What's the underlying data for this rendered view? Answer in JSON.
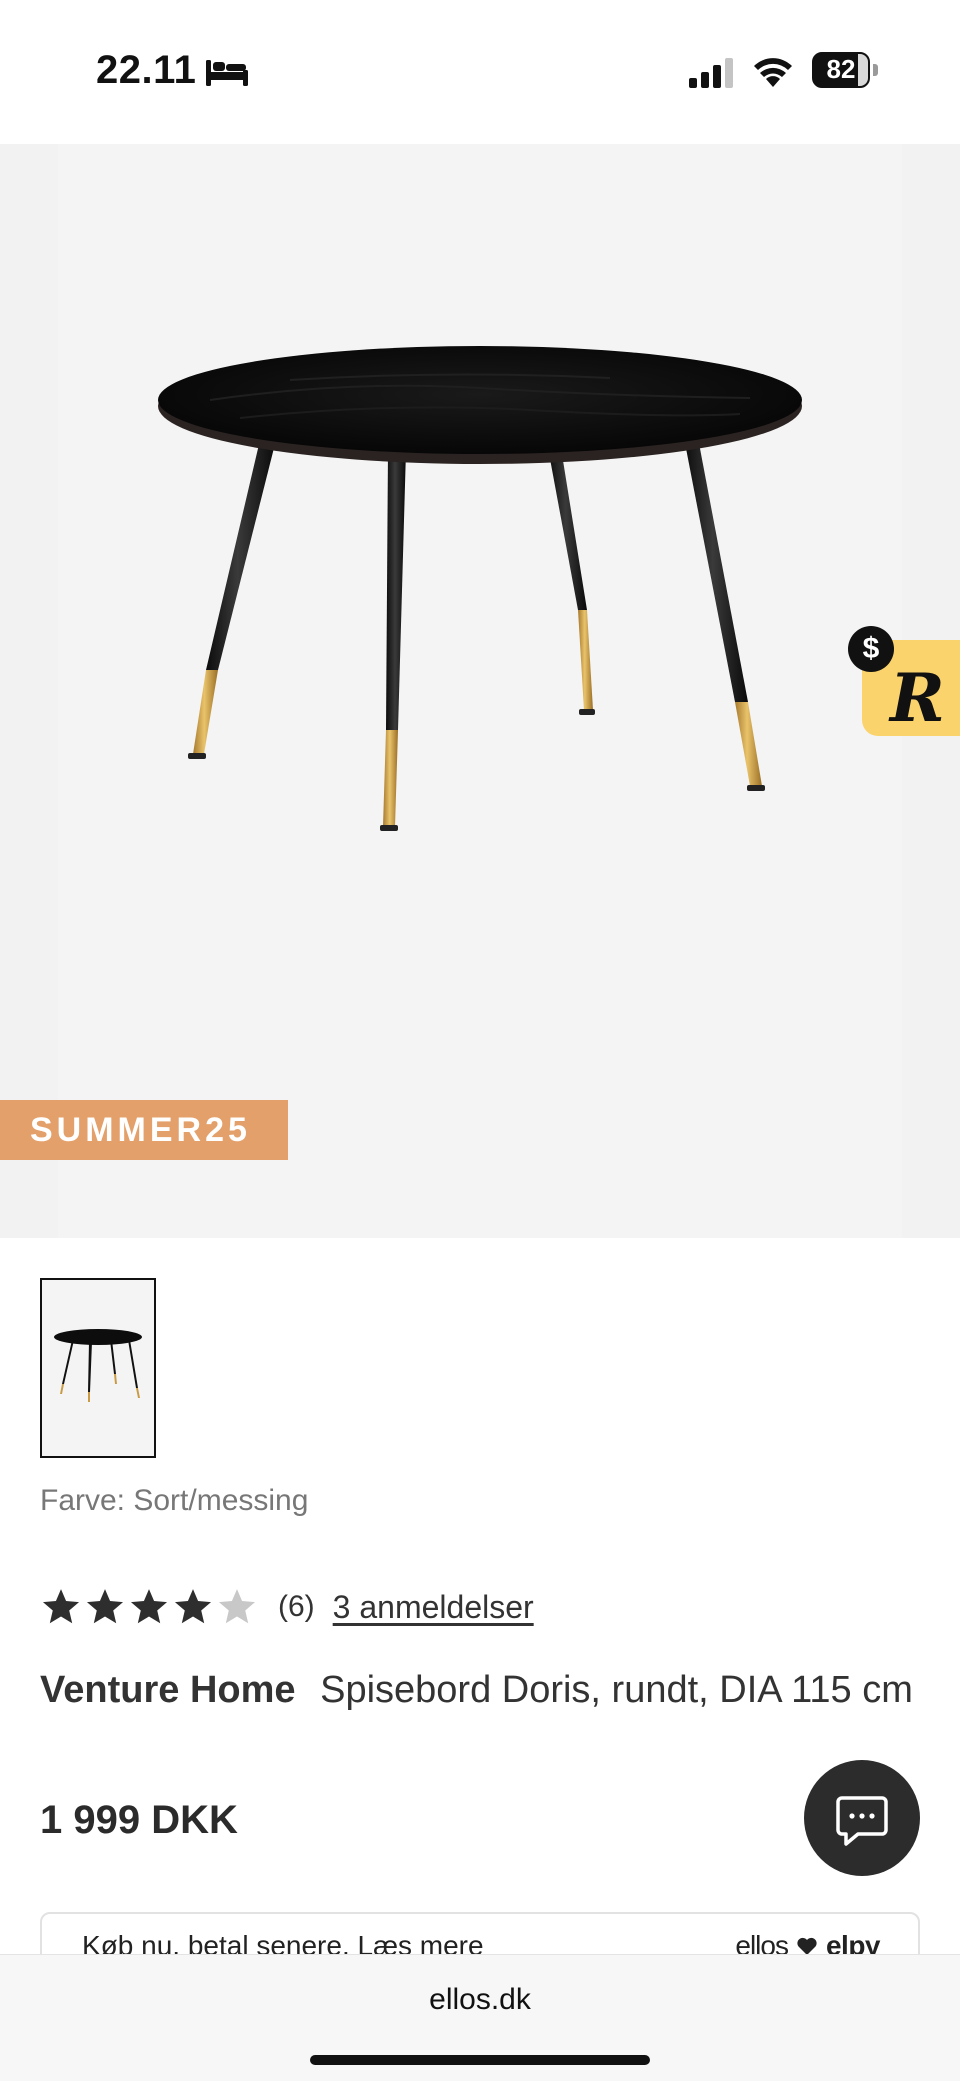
{
  "status_bar": {
    "time": "22.11",
    "battery": "82",
    "battery_level_percent": 82
  },
  "hero": {
    "promo_code": "SUMMER25",
    "cashback_symbol": "$",
    "cashback_letter": "R"
  },
  "product": {
    "color_label": "Farve: Sort/messing",
    "rating_stars": 4,
    "rating_max": 5,
    "rating_count": "(6)",
    "reviews_link": "3 anmeldelser",
    "brand": "Venture Home",
    "name": "Spisebord Doris, rundt, DIA 115 cm",
    "price": "1 999 DKK"
  },
  "paylater": {
    "text": "Køb nu, betal senere. Læs mere",
    "brand_left": "ellos",
    "brand_right": "elpy"
  },
  "browser": {
    "url": "ellos.dk"
  },
  "colors": {
    "promo_badge": "#e3a06a",
    "cashback_tab": "#fbd36d",
    "chat_button": "#2c2c2c",
    "star_filled": "#2e2e2e",
    "star_empty": "#c8c8c8"
  }
}
